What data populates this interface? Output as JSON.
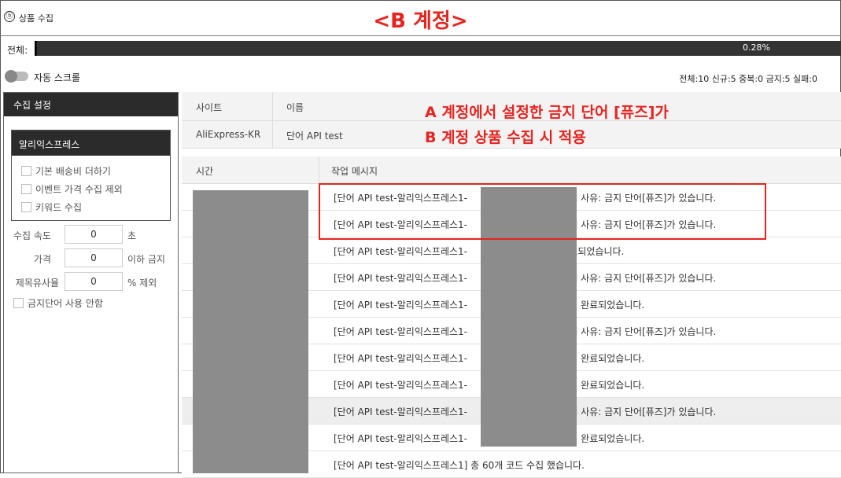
{
  "app": {
    "title": "상품 수집",
    "overlay_title": "<B 계정>"
  },
  "progress": {
    "label": "전체:",
    "percent_text": "0.28%",
    "fraction": 0.0028
  },
  "toggle": {
    "label": "자동 스크롤",
    "on": false
  },
  "stats": "전체:10 신규:5 중복:0 금지:5 실패:0",
  "left": {
    "header": "수집 설정",
    "group_title": "알리익스프레스",
    "checks": [
      "기본 배송비 더하기",
      "이벤트 가격 수집 제외",
      "키워드 수집"
    ],
    "fields": [
      {
        "label": "수집 속도",
        "value": "0",
        "suffix": "초"
      },
      {
        "label": "가격",
        "value": "0",
        "suffix": "이하 금지"
      },
      {
        "label": "제목유사율",
        "value": "0",
        "suffix": "% 제외"
      }
    ],
    "no_banned_check": "금지단어 사용 안함"
  },
  "site_table": {
    "headers": [
      "사이트",
      "이름"
    ],
    "row": [
      "AliExpress-KR",
      "단어 API test"
    ]
  },
  "log_table": {
    "headers": [
      "시간",
      "작업 메시지"
    ],
    "rows": [
      "[단어 API test-알리익스프레스1-                               실패 사유: 금지 단어[퓨즈]가 있습니다.",
      "[단어 API test-알리익스프레스1-                               실패 사유: 금지 단어[퓨즈]가 있습니다.",
      "[단어 API test-알리익스프레스1-                               완료되었습니다.",
      "[단어 API test-알리익스프레스1-                               실패 사유: 금지 단어[퓨즈]가 있습니다.",
      "[단어 API test-알리익스프레스1-                               수집 완료되었습니다.",
      "[단어 API test-알리익스프레스1-                               실패 사유: 금지 단어[퓨즈]가 있습니다.",
      "[단어 API test-알리익스프레스1-                               수집 완료되었습니다.",
      "[단어 API test-알리익스프레스1-                               수집 완료되었습니다.",
      "[단어 API test-알리익스프레스1-                               실패 사유: 금지 단어[퓨즈]가 있습니다.",
      "[단어 API test-알리익스프레스1-                               수집 완료되었습니다.",
      "[단어 API test-알리익스프레스1] 총 60개 코드 수집 했습니다."
    ]
  },
  "annotation": {
    "line1": "A 계정에서 설정한 금지 단어 [퓨즈]가",
    "line2": "B 계정 상품 수집 시 적용",
    "color": "#e8231f"
  }
}
